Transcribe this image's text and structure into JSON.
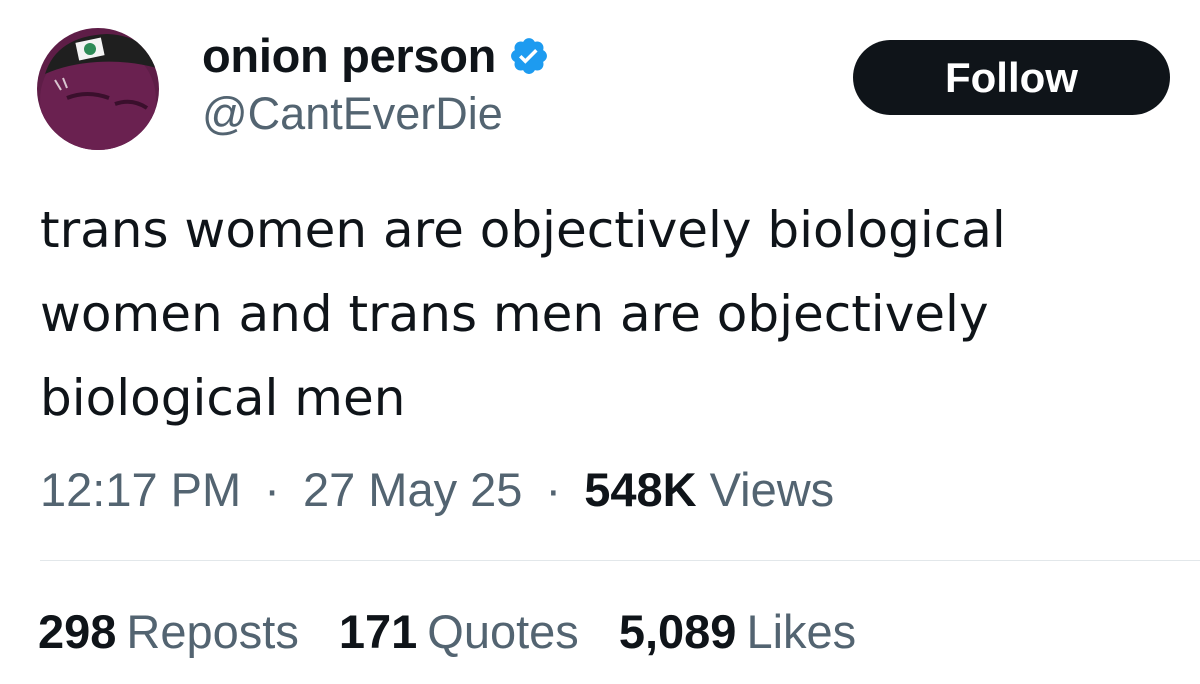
{
  "author": {
    "display_name": "onion person",
    "handle": "@CantEverDie",
    "verified": true,
    "verified_color": "#1d9bf0",
    "avatar_colors": {
      "background": "#5e1d47",
      "hat": "#1f1f1f"
    }
  },
  "follow_button": {
    "label": "Follow",
    "background": "#0f1419"
  },
  "tweet": {
    "lines": [
      "trans women are objectively biological",
      "women and trans men are objectively",
      "biological men"
    ]
  },
  "meta": {
    "time": "12:17 PM",
    "separator": "·",
    "date": "27 May 25",
    "views_count": "548K",
    "views_label": "Views"
  },
  "stats": {
    "reposts_count": "298",
    "reposts_label": "Reposts",
    "quotes_count": "171",
    "quotes_label": "Quotes",
    "likes_count": "5,089",
    "likes_label": "Likes"
  }
}
